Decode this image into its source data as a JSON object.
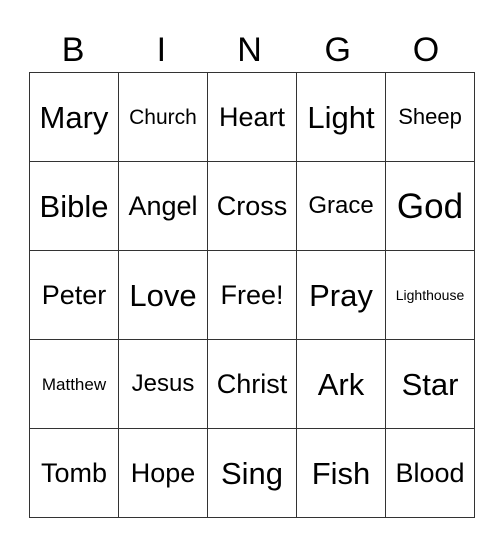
{
  "title_letters": [
    "B",
    "I",
    "N",
    "G",
    "O"
  ],
  "rows": [
    [
      "Mary",
      "Church",
      "Heart",
      "Light",
      "Sheep"
    ],
    [
      "Bible",
      "Angel",
      "Cross",
      "Grace",
      "God"
    ],
    [
      "Peter",
      "Love",
      "Free!",
      "Pray",
      "Lighthouse"
    ],
    [
      "Matthew",
      "Jesus",
      "Christ",
      "Ark",
      "Star"
    ],
    [
      "Tomb",
      "Hope",
      "Sing",
      "Fish",
      "Blood"
    ]
  ]
}
